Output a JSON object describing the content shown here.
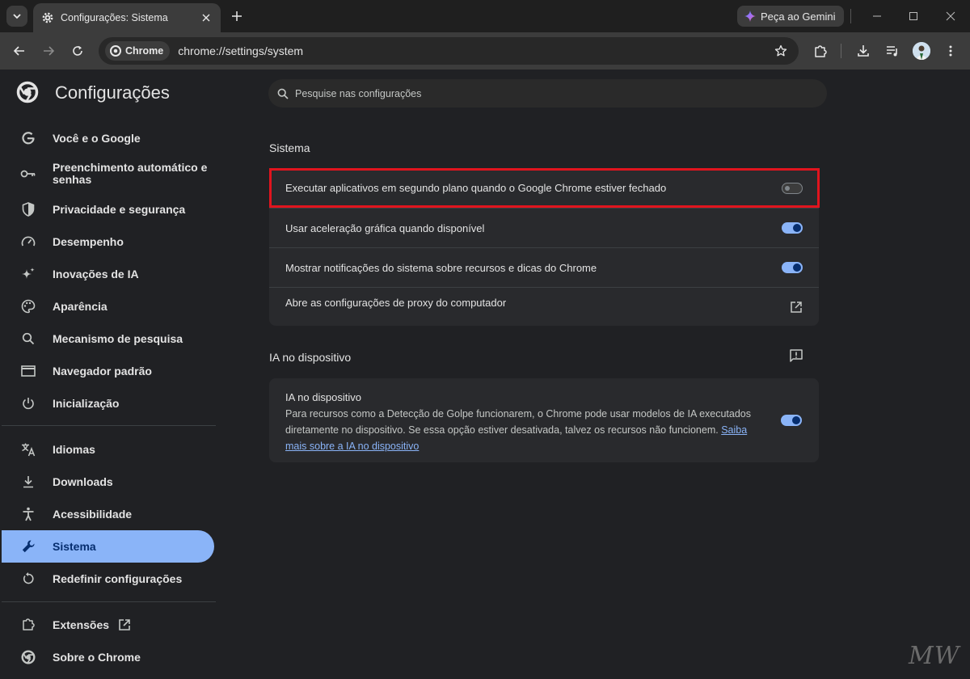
{
  "tab": {
    "title": "Configurações: Sistema"
  },
  "gemini_button": "Peça ao Gemini",
  "omnibox": {
    "chip_label": "Chrome",
    "url": "chrome://settings/system"
  },
  "sidebar": {
    "title": "Configurações",
    "items": [
      {
        "label": "Você e o Google",
        "icon": "google-icon"
      },
      {
        "label": "Preenchimento automático e senhas",
        "icon": "key-icon"
      },
      {
        "label": "Privacidade e segurança",
        "icon": "shield-icon"
      },
      {
        "label": "Desempenho",
        "icon": "speedometer-icon"
      },
      {
        "label": "Inovações de IA",
        "icon": "sparkle-icon"
      },
      {
        "label": "Aparência",
        "icon": "palette-icon"
      },
      {
        "label": "Mecanismo de pesquisa",
        "icon": "search-icon"
      },
      {
        "label": "Navegador padrão",
        "icon": "browser-window-icon"
      },
      {
        "label": "Inicialização",
        "icon": "power-icon"
      },
      {
        "label": "Idiomas",
        "icon": "translate-icon"
      },
      {
        "label": "Downloads",
        "icon": "download-icon"
      },
      {
        "label": "Acessibilidade",
        "icon": "accessibility-icon"
      },
      {
        "label": "Sistema",
        "icon": "wrench-icon",
        "active": true
      },
      {
        "label": "Redefinir configurações",
        "icon": "reset-icon"
      },
      {
        "label": "Extensões",
        "icon": "puzzle-icon"
      },
      {
        "label": "Sobre o Chrome",
        "icon": "chrome-icon"
      }
    ]
  },
  "search": {
    "placeholder": "Pesquise nas configurações"
  },
  "system_section": {
    "title": "Sistema",
    "rows": [
      {
        "label": "Executar aplicativos em segundo plano quando o Google Chrome estiver fechado",
        "toggle": false
      },
      {
        "label": "Usar aceleração gráfica quando disponível",
        "toggle": true
      },
      {
        "label": "Mostrar notificações do sistema sobre recursos e dicas do Chrome",
        "toggle": true
      },
      {
        "label": "Abre as configurações de proxy do computador",
        "action": "external-link-icon"
      }
    ]
  },
  "ai_section": {
    "title": "IA no dispositivo",
    "item_title": "IA no dispositivo",
    "description": "Para recursos como a Detecção de Golpe funcionarem, o Chrome pode usar modelos de IA executados diretamente no dispositivo. Se essa opção estiver desativada, talvez os recursos não funcionem.",
    "link": "Saiba mais sobre a IA no dispositivo",
    "toggle": true
  },
  "colors": {
    "accent": "#8ab4f8",
    "highlight_border": "#e0141e",
    "background": "#202124",
    "card": "#292a2d"
  },
  "watermark": "MW"
}
